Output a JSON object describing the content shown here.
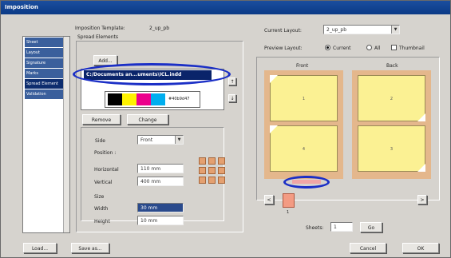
{
  "window": {
    "title": "Imposition"
  },
  "sidebar": {
    "items": [
      {
        "label": "Sheet"
      },
      {
        "label": "Layout"
      },
      {
        "label": "Signature"
      },
      {
        "label": "Marks"
      },
      {
        "label": "Spread Element"
      },
      {
        "label": "Validation"
      }
    ]
  },
  "template": {
    "label": "Imposition Template:",
    "value": "2_up_pb"
  },
  "spread": {
    "section_label": "Spread Elements",
    "add_label": "Add...",
    "file_path": "C:/Documents an...uments\\ICL.indd",
    "barcode_label": "#40b9d47",
    "remove_label": "Remove",
    "change_label": "Change",
    "side_label": "Side",
    "side_value": "Front",
    "position_label": "Position :",
    "horizontal_label": "Horizontal",
    "horizontal_value": "110 mm",
    "vertical_label": "Vertical",
    "vertical_value": "400 mm",
    "size_label": "Size",
    "width_label": "Width",
    "width_value": "30 mm",
    "height_label": "Height",
    "height_value": "10 mm",
    "up_arrow": "↑",
    "down_arrow": "↓"
  },
  "layout": {
    "current_label": "Current Layout:",
    "current_value": "2_up_pb",
    "preview_label": "Preview Layout:",
    "radio_current": "Current",
    "radio_all": "All",
    "thumbnail_label": "Thumbnail",
    "front_label": "Front",
    "back_label": "Back",
    "page_numbers": [
      "1",
      "4",
      "2",
      "3"
    ],
    "nav_left": "<",
    "nav_right": ">",
    "sheet_number": "1",
    "sheets_label": "Sheets:",
    "sheets_value": "1",
    "go_label": "Go"
  },
  "footer": {
    "load_label": "Load...",
    "save_label": "Save as...",
    "cancel_label": "Cancel",
    "ok_label": "OK"
  },
  "colors": {
    "title_bar": "#0b3a86",
    "page_fill": "#fbf193",
    "sheet_fill": "#e4b78c",
    "highlight_oval": "#1b2fc6",
    "selected_file": "#0a246a"
  },
  "swatches": [
    "#000000",
    "#fff200",
    "#ec008c",
    "#00aeef"
  ]
}
